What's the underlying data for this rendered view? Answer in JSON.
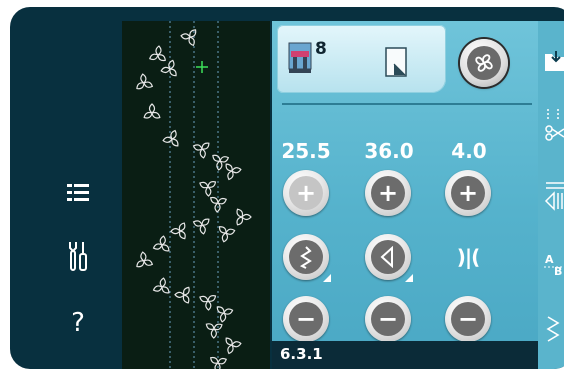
{
  "left_nav": {
    "items": [
      {
        "name": "menu-list-icon"
      },
      {
        "name": "settings-tools-icon"
      },
      {
        "name": "help-icon",
        "label": "?"
      }
    ]
  },
  "top_bar": {
    "presser_foot_number": "8",
    "presser_foot_icon": "presser-foot-icon",
    "stitch_menu_icon": "page-icon",
    "pattern_button_icon": "pattern-swirl-icon"
  },
  "settings": [
    {
      "value": "25.5",
      "mode_icon": "zigzag-width-icon"
    },
    {
      "value": "36.0",
      "mode_icon": "stitch-length-triangle-icon"
    },
    {
      "value": "4.0",
      "mode_icon": "density-icon",
      "mode_text": ")|("
    }
  ],
  "status": {
    "text": "6.3.1"
  },
  "right_strip": {
    "items": [
      {
        "name": "file-folder-icon"
      },
      {
        "name": "tie-off-scissors-icon"
      },
      {
        "name": "mirror-icon"
      },
      {
        "name": "alphabet-icon"
      },
      {
        "name": "stitch-program-icon"
      }
    ]
  },
  "colors": {
    "background": "#08303f",
    "panel": "#55b2cc",
    "preview": "#0a1e14",
    "cursor": "#3de05a"
  }
}
